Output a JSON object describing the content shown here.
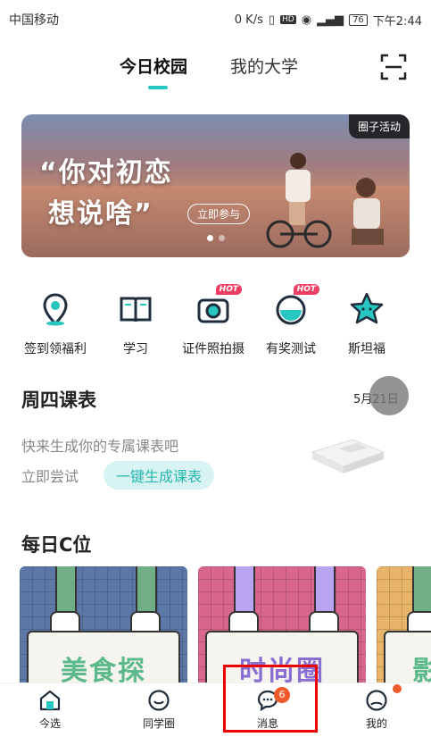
{
  "status": {
    "carrier": "中国移动",
    "speed": "0 K/s",
    "battery": "76",
    "time": "下午2:44"
  },
  "tabs": {
    "active": "今日校园",
    "other": "我的大学"
  },
  "banner": {
    "line1": "“你对初恋",
    "line2": "想说啥”",
    "cta": "立即参与",
    "tag": "圈子活动"
  },
  "quick": [
    {
      "label": "签到领福利",
      "icon": "location-pin-icon"
    },
    {
      "label": "学习",
      "icon": "book-icon"
    },
    {
      "label": "证件照拍摄",
      "icon": "camera-icon",
      "badge": "HOT"
    },
    {
      "label": "有奖测试",
      "icon": "quiz-icon",
      "badge": "HOT"
    },
    {
      "label": "斯坦福",
      "icon": "star-mascot-icon"
    }
  ],
  "schedule": {
    "title": "周四课表",
    "date": "5月21日",
    "hint": "快来生成你的专属课表吧",
    "try": "立即尝试",
    "button": "一键生成课表"
  },
  "daily": {
    "title": "每日C位",
    "cards": [
      {
        "text": "美食探",
        "color": "#5b78a6",
        "text_color": "#5bb98a"
      },
      {
        "text": "时尚圈",
        "color": "#d9668c",
        "text_color": "#8a6fd3"
      },
      {
        "text": "影",
        "color": "#e8b46a",
        "text_color": "#5bb98a"
      }
    ]
  },
  "nav": [
    {
      "label": "今选",
      "icon": "home-icon"
    },
    {
      "label": "同学圈",
      "icon": "smile-icon"
    },
    {
      "label": "消息",
      "icon": "chat-icon",
      "badge": "6"
    },
    {
      "label": "我的",
      "icon": "profile-icon"
    }
  ],
  "colors": {
    "accent": "#27c6c0",
    "badge": "#f15a2b",
    "hot": "#ef3e64"
  }
}
